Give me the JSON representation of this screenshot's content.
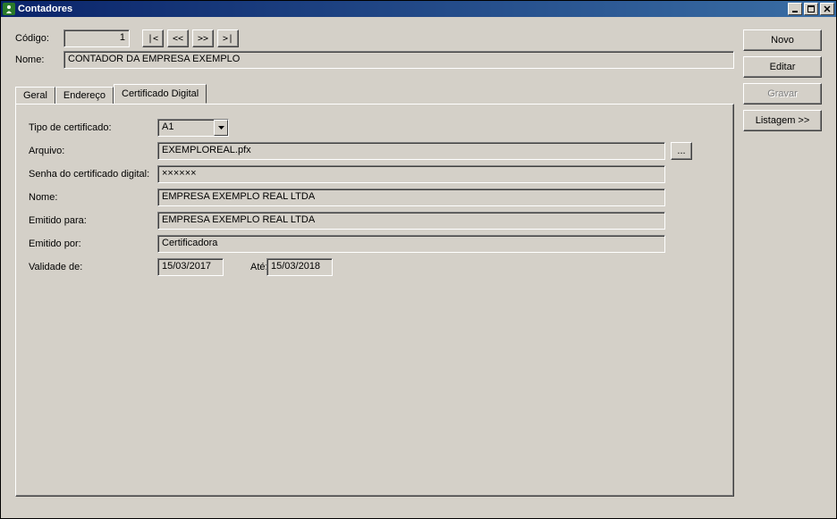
{
  "window": {
    "title": "Contadores"
  },
  "buttons": {
    "novo": "Novo",
    "editar": "Editar",
    "gravar": "Gravar",
    "listagem": "Listagem >>",
    "browse": "...",
    "nav_first": "|<",
    "nav_prev": "<<",
    "nav_next": ">>",
    "nav_last": ">|"
  },
  "labels": {
    "codigo": "Código:",
    "nome": "Nome:",
    "tipo_cert": "Tipo de certificado:",
    "arquivo": "Arquivo:",
    "senha": "Senha do certificado digital:",
    "nome_cert": "Nome:",
    "emitido_para": "Emitido para:",
    "emitido_por": "Emitido por:",
    "validade_de": "Validade de:",
    "ate": "Até:"
  },
  "tabs": {
    "geral": "Geral",
    "endereco": "Endereço",
    "certificado": "Certificado Digital"
  },
  "values": {
    "codigo": "1",
    "nome": "CONTADOR DA EMPRESA EXEMPLO",
    "tipo_cert": "A1",
    "arquivo": "EXEMPLOREAL.pfx",
    "senha": "××××××",
    "nome_cert": "EMPRESA EXEMPLO REAL LTDA",
    "emitido_para": "EMPRESA EXEMPLO REAL LTDA",
    "emitido_por": "Certificadora",
    "validade_de": "15/03/2017",
    "validade_ate": "15/03/2018"
  }
}
